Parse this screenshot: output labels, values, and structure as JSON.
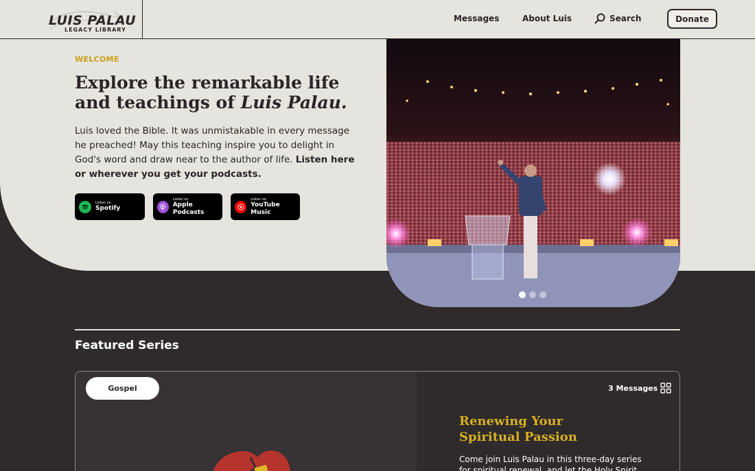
{
  "header": {
    "logo_main": "LUIS PALAU",
    "logo_sub": "LEGACY LIBRARY",
    "nav": [
      {
        "label": "Messages"
      },
      {
        "label": "About Luis"
      }
    ],
    "search_label": "Search",
    "donate_label": "Donate"
  },
  "hero": {
    "eyebrow": "WELCOME",
    "title_plain": "Explore the remarkable life and teachings of ",
    "title_italic": "Luis Palau.",
    "text_plain": "Luis loved the Bible. It was unmistakable in every message he preached! May this teaching inspire you to delight in God's word and draw near to the author of life. ",
    "text_bold": "Listen here or wherever you get your podcasts.",
    "podcasts": [
      {
        "small": "Listen on",
        "label": "Spotify",
        "icon": "spotify-icon",
        "color": "#1db954"
      },
      {
        "small": "Listen on",
        "label": "Apple Podcasts",
        "icon": "apple-podcasts-icon",
        "color": "#9b4fd6"
      },
      {
        "small": "Listen on",
        "label": "YouTube Music",
        "icon": "youtube-music-icon",
        "color": "#ff0000"
      }
    ],
    "carousel_slides": 3,
    "carousel_active": 1
  },
  "featured": {
    "heading": "Featured Series",
    "card": {
      "tag": "Gospel",
      "message_count": "3 Messages",
      "title": "Renewing Your Spiritual Passion",
      "description": "Come join Luis Palau in this three-day series for spiritual renewal, and let the Holy Spirit revive"
    }
  },
  "colors": {
    "accent_gold": "#c9a216",
    "series_title": "#d8b023",
    "dark_bg": "#2f2a2b",
    "light_bg": "#e6e4de"
  }
}
